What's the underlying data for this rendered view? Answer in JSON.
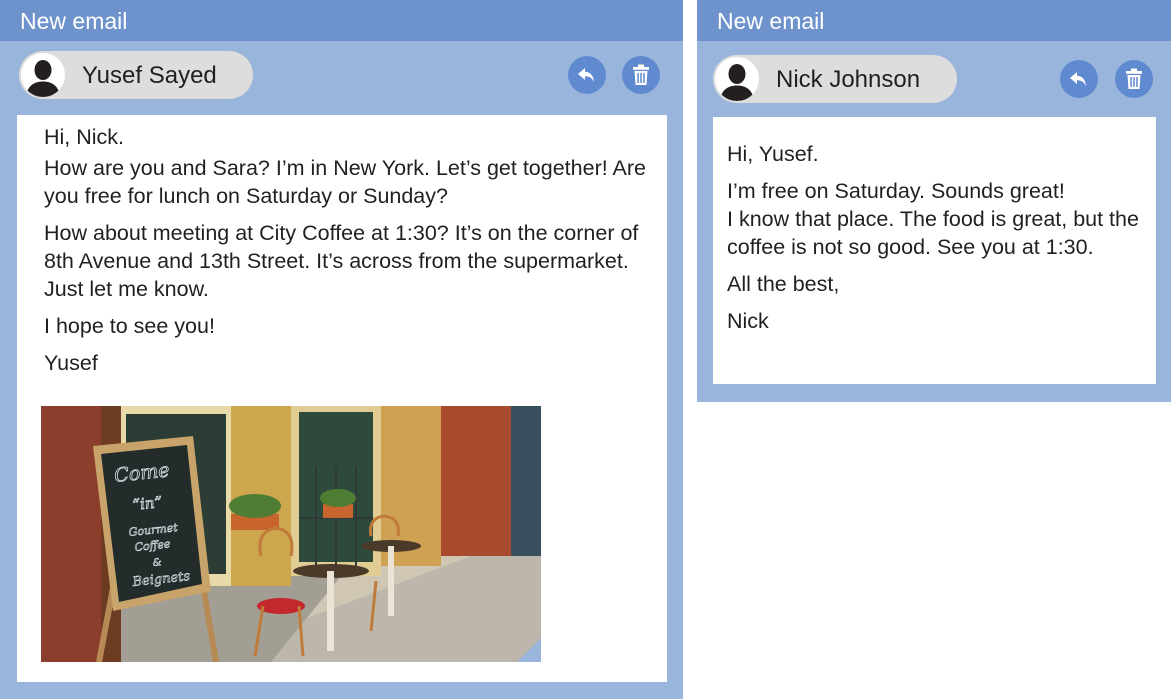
{
  "emails": [
    {
      "window_title": "New email",
      "sender_name": "Yusef Sayed",
      "paragraphs": [
        "Hi, Nick.",
        "How are you and Sara? I’m in New York. Let’s get together! Are you free for lunch on Saturday or Sunday?",
        "How about meeting at City Coffee at 1:30? It’s on the corner of 8th Avenue and 13th Street. It’s across from the supermarket. Just let me know.",
        "I hope to see you!",
        "Yusef"
      ],
      "photo": {
        "chalkboard_text": [
          "Come",
          "“in”",
          "Gourmet",
          "Coffee",
          "&",
          "Beignets"
        ]
      }
    },
    {
      "window_title": "New email",
      "sender_name": "Nick Johnson",
      "paragraphs": [
        "Hi, Yusef.",
        "I’m free on Saturday. Sounds great!",
        "I know that place. The food is great, but the coffee is not so good. See you at 1:30.",
        "All the best,",
        "Nick"
      ]
    }
  ],
  "icons": {
    "avatar": "person-silhouette-icon",
    "reply": "reply-arrow-icon",
    "delete": "trash-can-icon"
  },
  "colors": {
    "window_frame": "#9ab5dc",
    "title_bar": "#6e92cc",
    "action_button": "#5f8ad0",
    "sender_pill": "#dddddd"
  }
}
